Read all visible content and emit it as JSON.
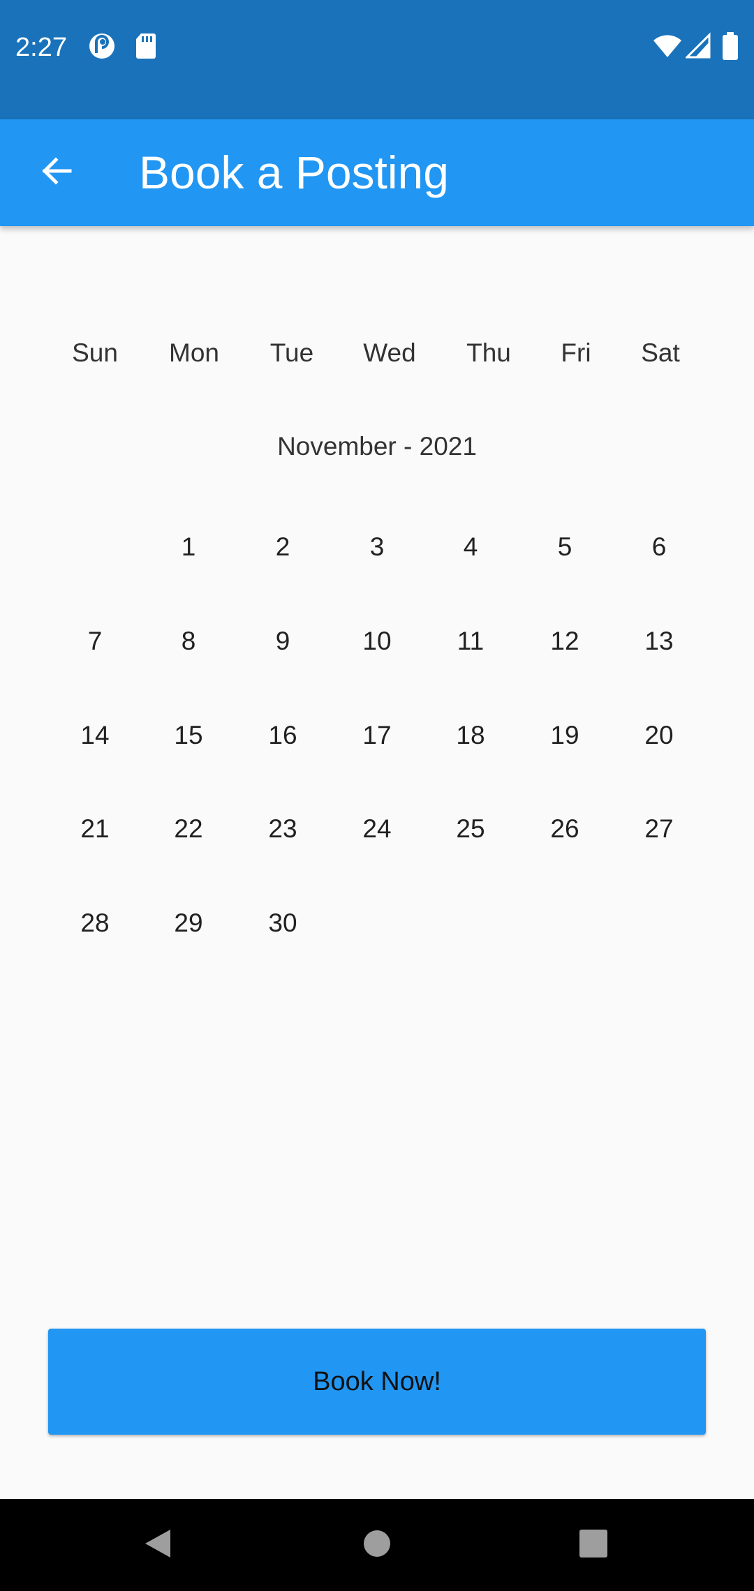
{
  "status_bar": {
    "time": "2:27",
    "icons": [
      "pocket-casts-icon",
      "sd-card-icon",
      "wifi-icon",
      "signal-icon",
      "battery-icon"
    ]
  },
  "app_bar": {
    "title": "Book a Posting",
    "back_icon": "arrow-left-icon"
  },
  "calendar": {
    "weekdays": [
      "Sun",
      "Mon",
      "Tue",
      "Wed",
      "Thu",
      "Fri",
      "Sat"
    ],
    "month_label": "November - 2021",
    "weeks": [
      [
        "",
        "1",
        "2",
        "3",
        "4",
        "5",
        "6"
      ],
      [
        "7",
        "8",
        "9",
        "10",
        "11",
        "12",
        "13"
      ],
      [
        "14",
        "15",
        "16",
        "17",
        "18",
        "19",
        "20"
      ],
      [
        "21",
        "22",
        "23",
        "24",
        "25",
        "26",
        "27"
      ],
      [
        "28",
        "29",
        "30",
        "",
        "",
        "",
        ""
      ]
    ]
  },
  "actions": {
    "book_label": "Book Now!"
  },
  "nav_bar": {
    "icons": [
      "back-triangle-icon",
      "home-circle-icon",
      "recents-square-icon"
    ]
  },
  "colors": {
    "status_bar": "#1A73BA",
    "app_bar": "#2196F3",
    "button": "#2196F3",
    "background": "#FAFAFA"
  }
}
